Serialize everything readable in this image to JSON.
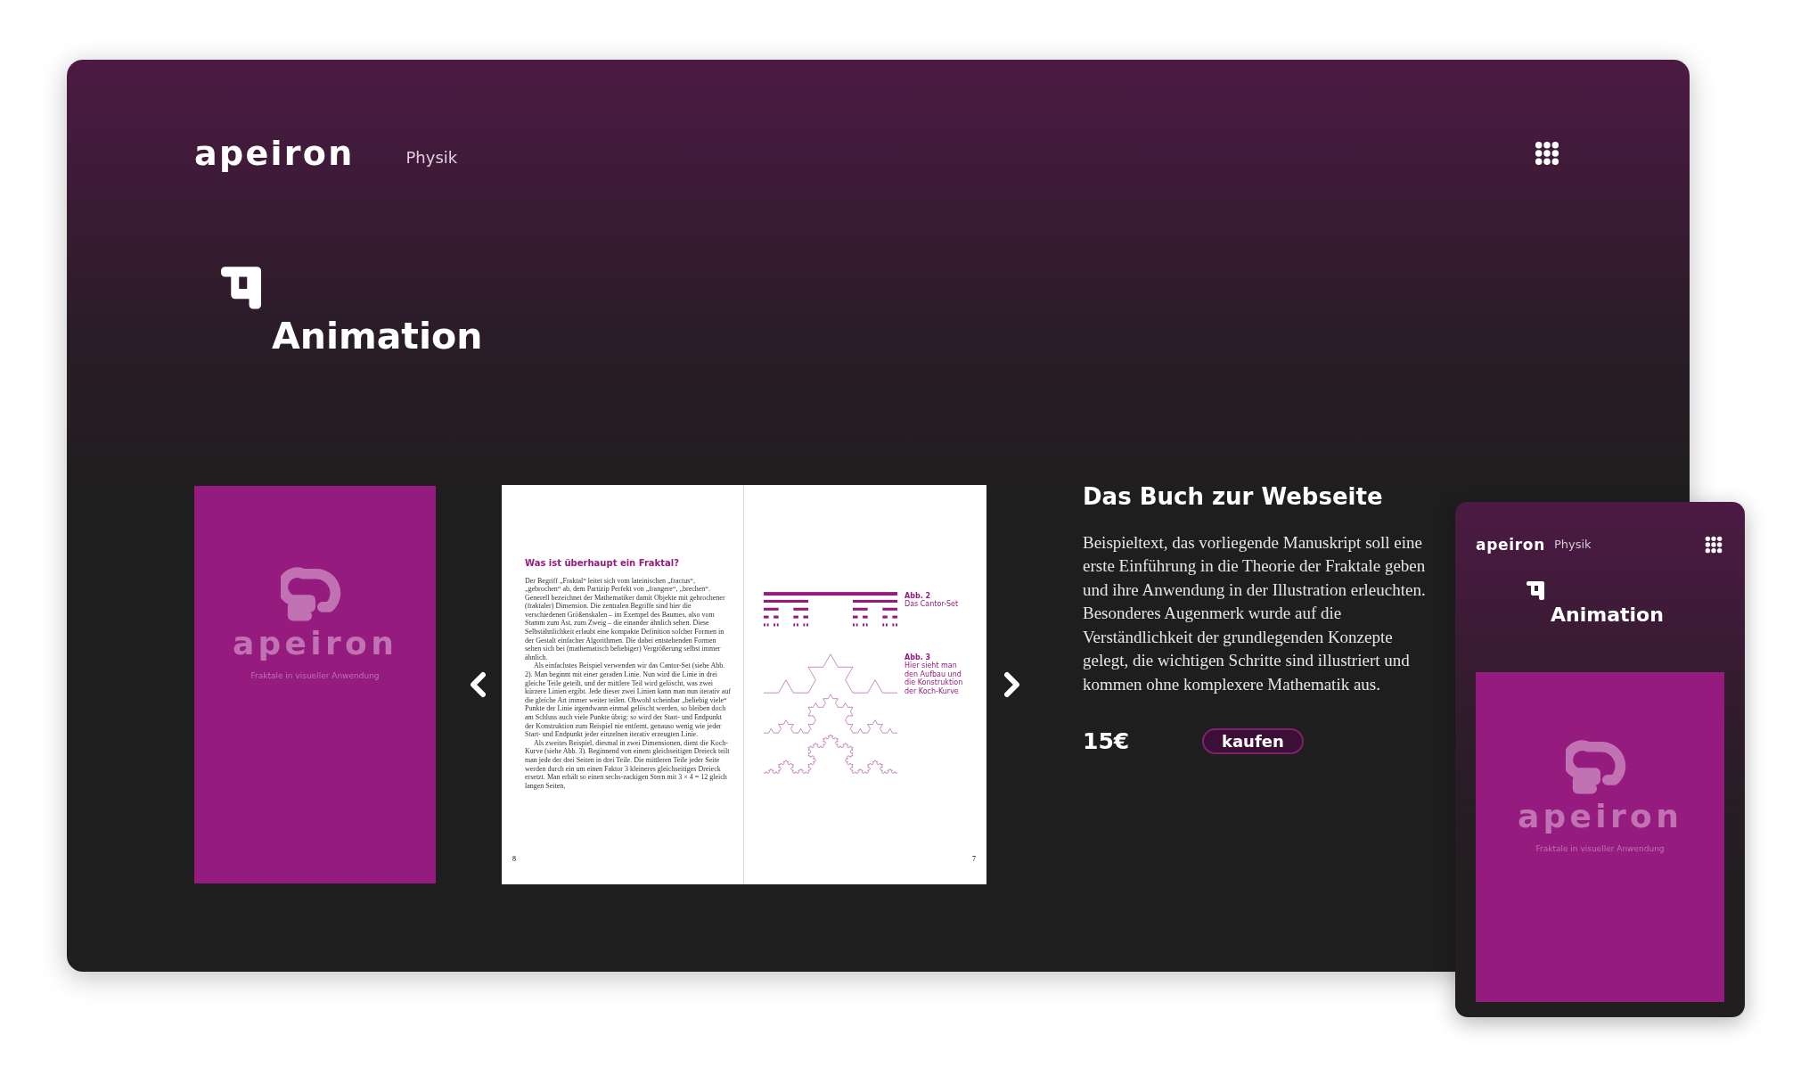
{
  "desktop": {
    "header": {
      "logo": "apeiron",
      "section": "Physik"
    },
    "page_title": "Animation",
    "cover": {
      "logo": "apeiron",
      "subtitle": "Fraktale in visueller Anwendung"
    },
    "spread": {
      "left_page": {
        "heading": "Was ist überhaupt ein Fraktal?",
        "paragraphs": [
          "Der Begriff „Fraktal“ leitet sich vom lateinischen „fractus“, „gebrochen“ ab, dem Partizip Perfekt von „frangere“, „brechen“. Generell bezeichnet der Mathematiker damit Objekte mit gebrochener (fraktaler) Dimension. Die zentralen Begriffe sind hier die verschiedenen Größenskalen – im Exempel des Baumes, also vom Stamm zum Ast, zum Zweig – die einander ähnlich sehen. Diese Selbstähnlichkeit erlaubt eine kompakte Definition solcher Formen in der Gestalt einfacher Algorithmen. Die dabei entstehenden Formen sehen sich bei (mathematisch beliebiger) Vergrößerung selbst immer ähnlich.",
          "Als einfachstes Beispiel verwenden wir das Cantor-Set (siehe Abb. 2). Man beginnt mit einer geraden Linie. Nun wird die Linie in drei gleiche Teile geteilt, und der mittlere Teil wird gelöscht, was zwei kürzere Linien ergibt. Jede dieser zwei Linien kann man nun iterativ auf die gleiche Art immer weiter teilen. Obwohl scheinbar „beliebig viele“ Punkte der Linie irgendwann einmal gelöscht werden, so bleiben doch am Schluss auch viele Punkte übrig: so wird der Start- und Endpunkt der Konstruktion zum Beispiel nie entfernt, genauso wenig wie jeder Start- und Endpunkt jeder einzelnen iterativ erzeugten Linie.",
          "Als zweites Beispiel, diesmal in zwei Dimensionen, dient die Koch-Kurve (siehe Abb. 3). Beginnend von einem gleichseitigen Dreieck teilt man jede der drei Seiten in drei Teile. Die mittleren Teile jeder Seite werden durch ein um einen Faktor 3 kleineres gleichseitiges Dreieck ersetzt. Man erhält so einen sechs-zackigen Stern mit 3 × 4 = 12 gleich langen Seiten,"
        ],
        "page_number": "8"
      },
      "right_page": {
        "figures": [
          {
            "kind": "cantor",
            "label": "Abb. 2",
            "caption": "Das Cantor-Set"
          },
          {
            "kind": "koch",
            "label": "Abb. 3",
            "caption": "Hier sieht man den Aufbau und die Konstruktion der Koch-Kurve"
          }
        ],
        "page_number": "7"
      }
    },
    "book": {
      "title": "Das Buch zur Webseite",
      "description": "Beispieltext, das vorliegende Manuskript soll eine erste Einführung in die Theorie der Fraktale geben und ihre Anwendung in der Illustration erleuchten. Besonderes Augenmerk wurde auf die Verständlichkeit der grundlegenden Konzepte gelegt, die wichtigen Schritte sind illustriert und kommen ohne komplexere Mathematik aus.",
      "price": "15€",
      "buy_button": "kaufen"
    }
  },
  "mobile": {
    "header": {
      "logo": "apeiron",
      "section": "Physik"
    },
    "page_title": "Animation",
    "cover": {
      "logo": "apeiron",
      "subtitle": "Fraktale in visueller Anwendung"
    }
  }
}
